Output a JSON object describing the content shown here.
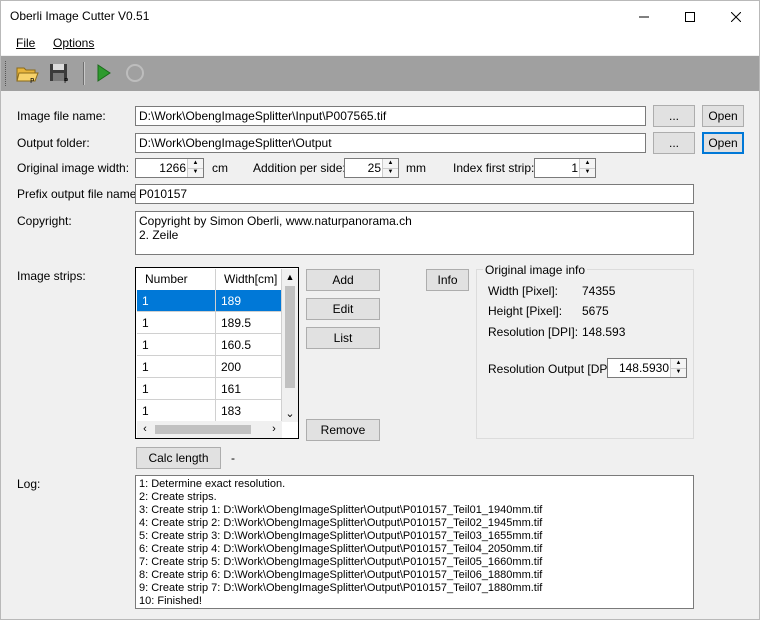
{
  "window": {
    "title": "Oberli Image Cutter V0.51"
  },
  "menu": {
    "file": "File",
    "options": "Options"
  },
  "form": {
    "image_file_label": "Image file name:",
    "image_file_value": "D:\\Work\\ObengImageSplitter\\Input\\P007565.tif",
    "output_folder_label": "Output folder:",
    "output_folder_value": "D:\\Work\\ObengImageSplitter\\Output",
    "browse_label": "...",
    "open_label": "Open",
    "orig_width_label": "Original image width:",
    "orig_width_value": "1266",
    "orig_width_unit": "cm",
    "addition_label": "Addition per side:",
    "addition_value": "25",
    "addition_unit": "mm",
    "index_label": "Index first strip:",
    "index_value": "1",
    "prefix_label": "Prefix output file name:",
    "prefix_value": "P010157",
    "copyright_label": "Copyright:",
    "copyright_line1": "Copyright by Simon Oberli, www.naturpanorama.ch",
    "copyright_line2": "2. Zeile",
    "strips_label": "Image strips:",
    "log_label": "Log:"
  },
  "strips": {
    "headers": [
      "Number",
      "Width[cm]"
    ],
    "rows": [
      [
        "1",
        "189"
      ],
      [
        "1",
        "189.5"
      ],
      [
        "1",
        "160.5"
      ],
      [
        "1",
        "200"
      ],
      [
        "1",
        "161"
      ],
      [
        "1",
        "183"
      ]
    ]
  },
  "buttons": {
    "add": "Add",
    "edit": "Edit",
    "list": "List",
    "remove": "Remove",
    "info": "Info",
    "calc": "Calc length",
    "calc_result": "-"
  },
  "info": {
    "group_title": "Original image info",
    "width_label": "Width [Pixel]:",
    "width_value": "74355",
    "height_label": "Height [Pixel]:",
    "height_value": "5675",
    "res_label": "Resolution [DPI]:",
    "res_value": "148.593",
    "res_out_label": "Resolution Output [DPI:",
    "res_out_value": "148.5930"
  },
  "log": {
    "lines": [
      "1: Determine exact resolution.",
      "2: Create strips.",
      "3: Create strip 1: D:\\Work\\ObengImageSplitter\\Output\\P010157_Teil01_1940mm.tif",
      "4: Create strip 2: D:\\Work\\ObengImageSplitter\\Output\\P010157_Teil02_1945mm.tif",
      "5: Create strip 3: D:\\Work\\ObengImageSplitter\\Output\\P010157_Teil03_1655mm.tif",
      "6: Create strip 4: D:\\Work\\ObengImageSplitter\\Output\\P010157_Teil04_2050mm.tif",
      "7: Create strip 5: D:\\Work\\ObengImageSplitter\\Output\\P010157_Teil05_1660mm.tif",
      "8: Create strip 6: D:\\Work\\ObengImageSplitter\\Output\\P010157_Teil06_1880mm.tif",
      "9: Create strip 7: D:\\Work\\ObengImageSplitter\\Output\\P010157_Teil07_1880mm.tif",
      "10: Finished!"
    ]
  },
  "colors": {
    "selection": "#0078d7",
    "toolbar": "#a0a0a0",
    "play": "#2e9b2e"
  },
  "icons": [
    "open-folder-icon",
    "save-icon",
    "play-icon",
    "stop-icon",
    "minimize-icon",
    "maximize-icon",
    "close-icon"
  ]
}
